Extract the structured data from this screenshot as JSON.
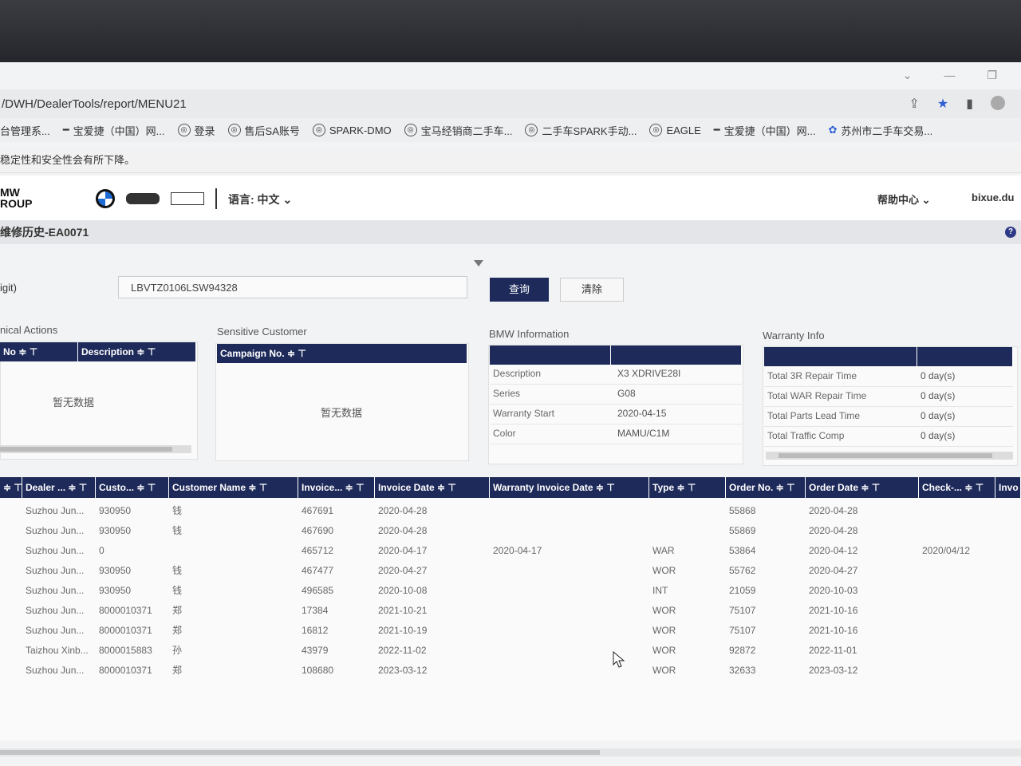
{
  "browser": {
    "url": "/DWH/DealerTools/report/MENU21",
    "bookmarks": [
      "台管理系...",
      "宝爱捷（中国）网...",
      "登录",
      "售后SA账号",
      "SPARK-DMO",
      "宝马经销商二手车...",
      "二手车SPARK手动...",
      "EAGLE",
      "宝爱捷（中国）网...",
      "苏州市二手车交易..."
    ],
    "warning": "稳定性和安全性会有所下降。"
  },
  "header": {
    "logo_line1": "MW",
    "logo_line2": "ROUP",
    "language_label": "语言: 中文",
    "help": "帮助中心",
    "user": "bixue.du"
  },
  "page": {
    "title": "维修历史-EA0071",
    "vin_label": "igit)",
    "vin_value": "LBVTZ0106LSW94328",
    "query_button": "查询",
    "clear_button": "清除"
  },
  "technical_actions": {
    "title": "nical Actions",
    "columns": [
      "No ≑ ⊤",
      "Description ≑ ⊤"
    ],
    "empty": "暂无数据"
  },
  "sensitive_customer": {
    "title": "Sensitive Customer",
    "columns": [
      "Campaign No. ≑ ⊤"
    ],
    "empty": "暂无数据"
  },
  "bmw_information": {
    "title": "BMW Information",
    "rows": [
      {
        "k": "Description",
        "v": "X3 XDRIVE28I"
      },
      {
        "k": "Series",
        "v": "G08"
      },
      {
        "k": "Warranty Start",
        "v": "2020-04-15"
      },
      {
        "k": "Color",
        "v": "MAMU/C1M"
      }
    ]
  },
  "warranty_info": {
    "title": "Warranty Info",
    "rows": [
      {
        "k": "Total 3R Repair Time",
        "v": "0 day(s)"
      },
      {
        "k": "Total WAR Repair Time",
        "v": "0 day(s)"
      },
      {
        "k": "Total Parts Lead Time",
        "v": "0 day(s)"
      },
      {
        "k": "Total Traffic Comp",
        "v": "0 day(s)"
      }
    ]
  },
  "history": {
    "columns": [
      "≑ ⊤",
      "Dealer ... ≑ ⊤",
      "Custo... ≑ ⊤",
      "Customer Name ≑ ⊤",
      "Invoice... ≑ ⊤",
      "Invoice Date ≑ ⊤",
      "Warranty Invoice Date ≑ ⊤",
      "Type ≑ ⊤",
      "Order No. ≑ ⊤",
      "Order Date ≑ ⊤",
      "Check-... ≑ ⊤",
      "Invo"
    ],
    "rows": [
      [
        "Suzhou Jun...",
        "930950",
        "钱",
        "467691",
        "2020-04-28",
        "",
        "",
        "55868",
        "2020-04-28",
        ""
      ],
      [
        "Suzhou Jun...",
        "930950",
        "钱",
        "467690",
        "2020-04-28",
        "",
        "",
        "55869",
        "2020-04-28",
        ""
      ],
      [
        "Suzhou Jun...",
        "0",
        "",
        "465712",
        "2020-04-17",
        "2020-04-17",
        "WAR",
        "53864",
        "2020-04-12",
        "2020/04/12"
      ],
      [
        "Suzhou Jun...",
        "930950",
        "钱",
        "467477",
        "2020-04-27",
        "",
        "WOR",
        "55762",
        "2020-04-27",
        ""
      ],
      [
        "Suzhou Jun...",
        "930950",
        "钱",
        "496585",
        "2020-10-08",
        "",
        "INT",
        "21059",
        "2020-10-03",
        ""
      ],
      [
        "Suzhou Jun...",
        "8000010371",
        "郑",
        "17384",
        "2021-10-21",
        "",
        "WOR",
        "75107",
        "2021-10-16",
        ""
      ],
      [
        "Suzhou Jun...",
        "8000010371",
        "郑",
        "16812",
        "2021-10-19",
        "",
        "WOR",
        "75107",
        "2021-10-16",
        ""
      ],
      [
        "Taizhou Xinb...",
        "8000015883",
        "孙",
        "43979",
        "2022-11-02",
        "",
        "WOR",
        "92872",
        "2022-11-01",
        ""
      ],
      [
        "Suzhou Jun...",
        "8000010371",
        "郑",
        "108680",
        "2023-03-12",
        "",
        "WOR",
        "32633",
        "2023-03-12",
        ""
      ]
    ]
  }
}
